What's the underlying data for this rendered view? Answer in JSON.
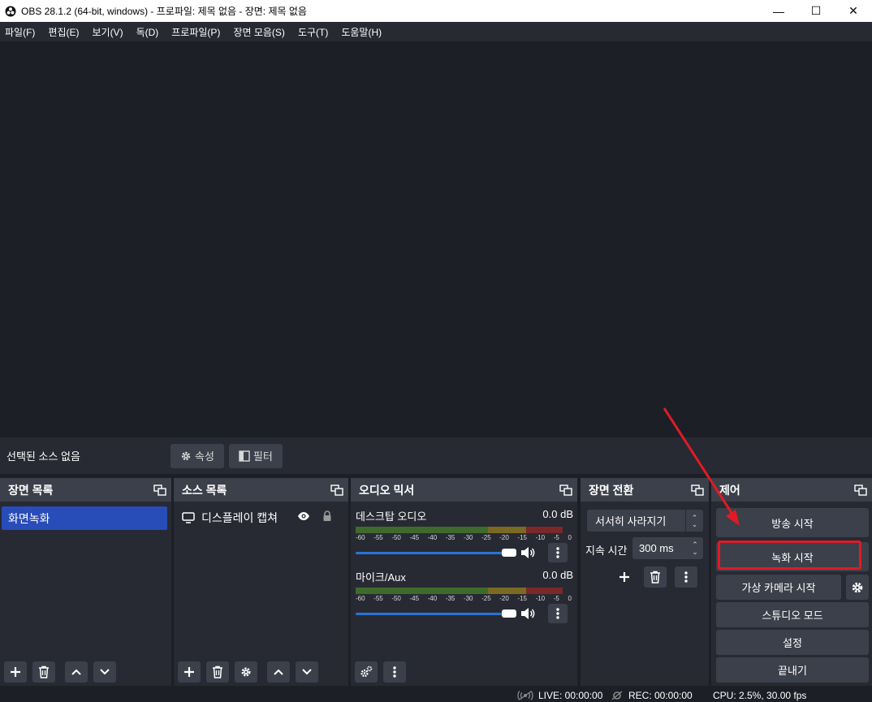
{
  "window": {
    "title": "OBS 28.1.2 (64-bit, windows) - 프로파일: 제목 없음 - 장면: 제목 없음",
    "minimize": "—",
    "maximize": "☐",
    "close": "✕"
  },
  "menu": [
    "파일(F)",
    "편집(E)",
    "보기(V)",
    "독(D)",
    "프로파일(P)",
    "장면 모음(S)",
    "도구(T)",
    "도움말(H)"
  ],
  "context": {
    "no_source": "선택된 소스 없음",
    "properties": "속성",
    "filters": "필터"
  },
  "docks": {
    "scenes": {
      "title": "장면 목록",
      "items": [
        "화면녹화"
      ]
    },
    "sources": {
      "title": "소스 목록",
      "items": [
        "디스플레이 캡쳐"
      ]
    },
    "mixer": {
      "title": "오디오 믹서",
      "channels": [
        {
          "name": "데스크탑 오디오",
          "db": "0.0 dB",
          "volume": 1.0
        },
        {
          "name": "마이크/Aux",
          "db": "0.0 dB",
          "volume": 1.0
        }
      ],
      "ticks": [
        "-60",
        "-55",
        "-50",
        "-45",
        "-40",
        "-35",
        "-30",
        "-25",
        "-20",
        "-15",
        "-10",
        "-5",
        "0"
      ]
    },
    "transitions": {
      "title": "장면 전환",
      "selected": "서서히 사라지기",
      "duration_label": "지속 시간",
      "duration": "300 ms"
    },
    "controls": {
      "title": "제어",
      "start_streaming": "방송 시작",
      "start_recording": "녹화 시작",
      "start_virtual_cam": "가상 카메라 시작",
      "studio_mode": "스튜디오 모드",
      "settings": "설정",
      "exit": "끝내기"
    }
  },
  "status": {
    "live": "LIVE: 00:00:00",
    "rec": "REC: 00:00:00",
    "cpu": "CPU: 2.5%, 30.00 fps"
  },
  "annotation_color": "#e01b24"
}
